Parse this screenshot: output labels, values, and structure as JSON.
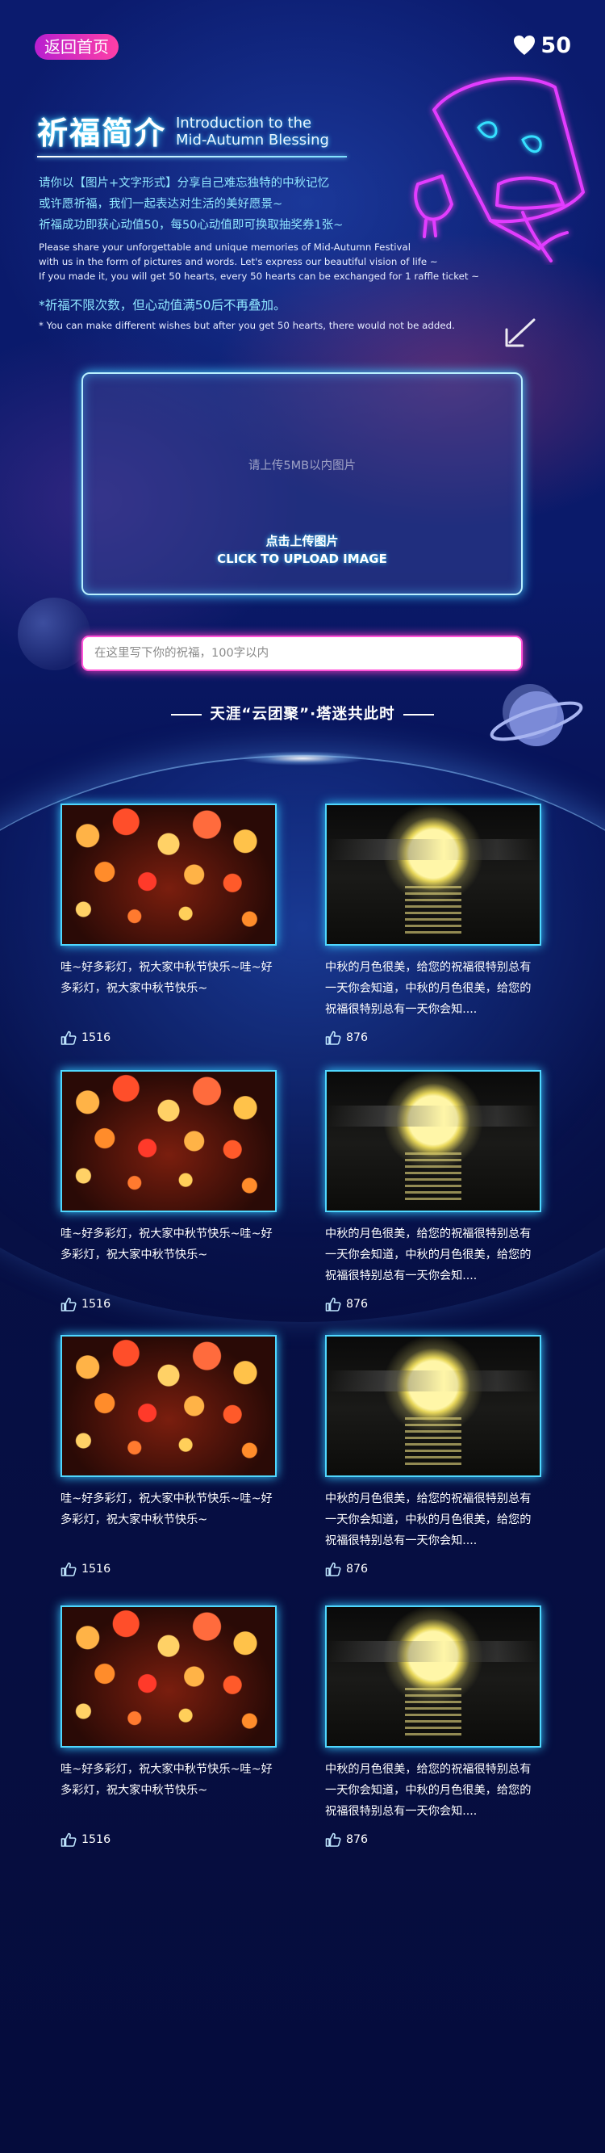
{
  "header": {
    "back_label": "返回首页",
    "hearts_count": "50",
    "heart_icon": "heart-icon"
  },
  "intro": {
    "title_cn": "祈福简介",
    "title_en_line1": "Introduction to the",
    "title_en_line2": "Mid-Autumn Blessing",
    "desc_cn_1": "请你以【图片+文字形式】分享自己难忘独特的中秋记忆",
    "desc_cn_2": "或许愿祈福，我们一起表达对生活的美好愿景~",
    "desc_cn_3": "祈福成功即获心动值50，每50心动值即可换取抽奖券1张~",
    "desc_en_1": "Please share your unforgettable and unique memories of Mid-Autumn Festival",
    "desc_en_2": "with us in the form of pictures and words. Let's express our beautiful vision of life ~",
    "desc_en_3": "If you made it, you will get 50 hearts, every 50 hearts can be exchanged for 1 raffle ticket ~",
    "note_cn": "*祈福不限次数，但心动值满50后不再叠加。",
    "note_en": "* You can make different wishes but after you get 50 hearts, there would not be added."
  },
  "upload": {
    "placeholder": "请上传5MB以内图片",
    "button_cn": "点击上传图片",
    "button_en": "CLICK TO UPLOAD IMAGE"
  },
  "wish_input": {
    "placeholder": "在这里写下你的祝福，100字以内",
    "value": ""
  },
  "gallery": {
    "title": "天涯“云团聚”·塔迷共此时",
    "cards": [
      {
        "image": "lanterns",
        "text": "哇~好多彩灯，祝大家中秋节快乐~哇~好多彩灯，祝大家中秋节快乐~",
        "likes": "1516"
      },
      {
        "image": "moon",
        "text": "中秋的月色很美，给您的祝福很特别总有一天你会知道，中秋的月色很美，给您的祝福很特别总有一天你会知....",
        "likes": "876"
      },
      {
        "image": "lanterns",
        "text": "哇~好多彩灯，祝大家中秋节快乐~哇~好多彩灯，祝大家中秋节快乐~",
        "likes": "1516"
      },
      {
        "image": "moon",
        "text": "中秋的月色很美，给您的祝福很特别总有一天你会知道，中秋的月色很美，给您的祝福很特别总有一天你会知....",
        "likes": "876"
      },
      {
        "image": "lanterns",
        "text": "哇~好多彩灯，祝大家中秋节快乐~哇~好多彩灯，祝大家中秋节快乐~",
        "likes": "1516"
      },
      {
        "image": "moon",
        "text": "中秋的月色很美，给您的祝福很特别总有一天你会知道，中秋的月色很美，给您的祝福很特别总有一天你会知....",
        "likes": "876"
      },
      {
        "image": "lanterns",
        "text": "哇~好多彩灯，祝大家中秋节快乐~哇~好多彩灯，祝大家中秋节快乐~",
        "likes": "1516"
      },
      {
        "image": "moon",
        "text": "中秋的月色很美，给您的祝福很特别总有一天你会知道，中秋的月色很美，给您的祝福很特别总有一天你会知....",
        "likes": "876"
      }
    ]
  },
  "colors": {
    "background": "#0a1a6a",
    "accent_cyan": "#4fd8ff",
    "accent_pink": "#ff3fa6",
    "neon_magenta": "#e23cff"
  }
}
